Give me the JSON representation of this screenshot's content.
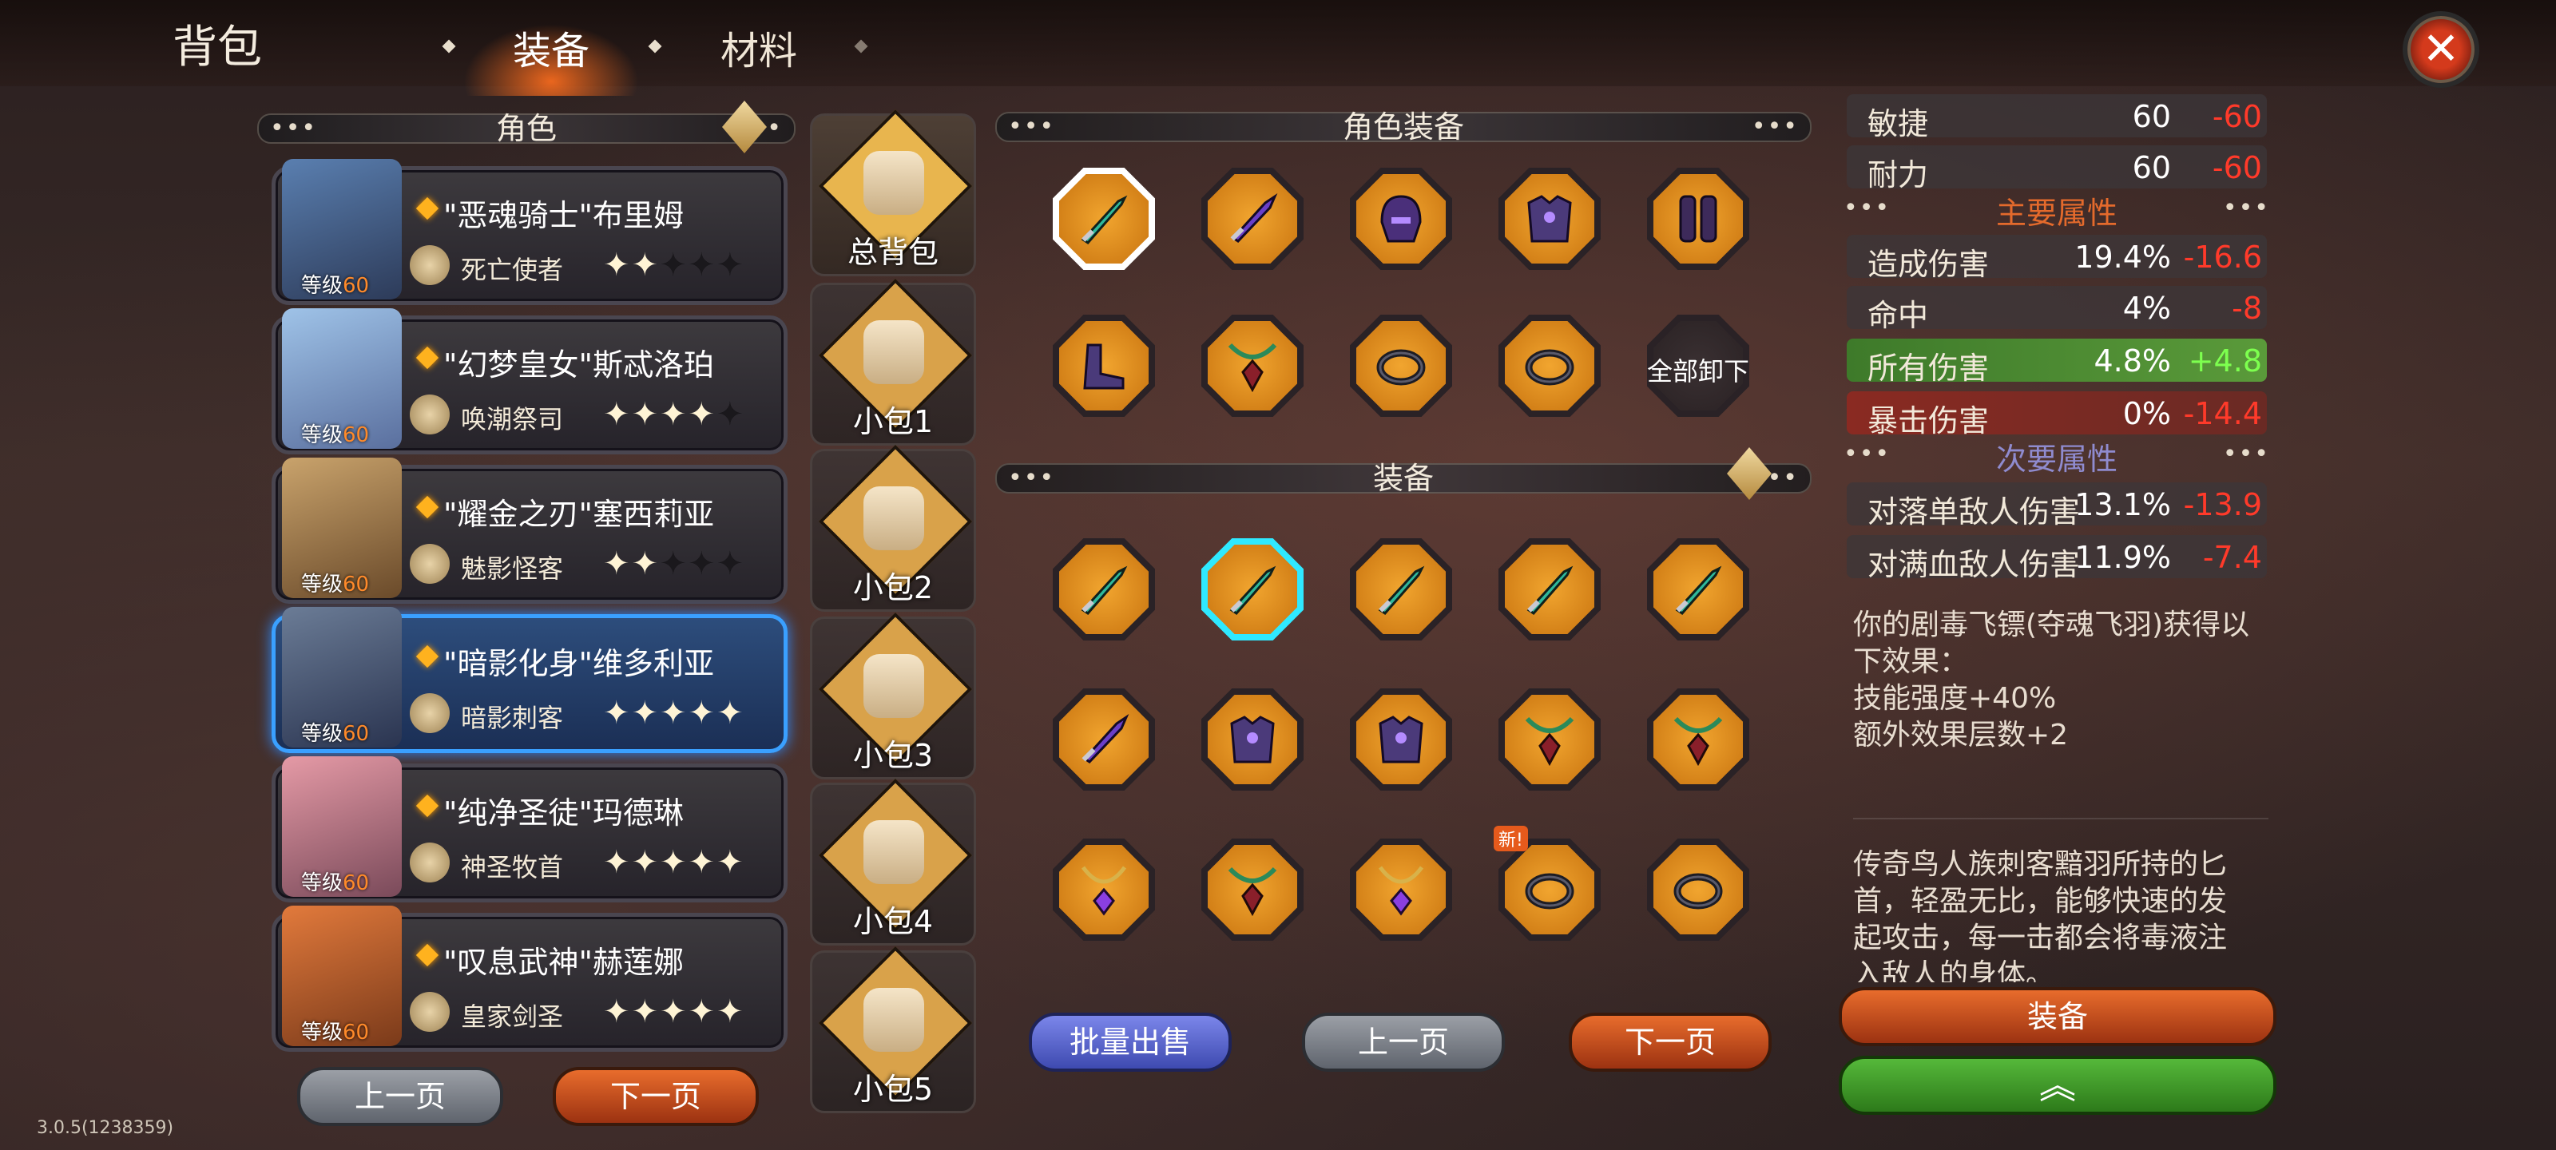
{
  "header": {
    "title": "背包",
    "tabs": [
      "装备",
      "材料"
    ]
  },
  "characters_panel": {
    "title": "角色",
    "characters": [
      {
        "name": "\"恶魂骑士\"布里姆",
        "class": "死亡使者",
        "level_label": "等级",
        "level": "60",
        "stars": 2,
        "colors": [
          "#5a7fb0",
          "#2d3b59"
        ]
      },
      {
        "name": "\"幻梦皇女\"斯忒洛珀",
        "class": "唤潮祭司",
        "level_label": "等级",
        "level": "60",
        "stars": 4,
        "colors": [
          "#9fc3e8",
          "#5a6f9e"
        ]
      },
      {
        "name": "\"耀金之刃\"塞西莉亚",
        "class": "魅影怪客",
        "level_label": "等级",
        "level": "60",
        "stars": 2,
        "colors": [
          "#c9a36c",
          "#6a4a2a"
        ]
      },
      {
        "name": "\"暗影化身\"维多利亚",
        "class": "暗影刺客",
        "level_label": "等级",
        "level": "60",
        "stars": 5,
        "selected": true,
        "colors": [
          "#6b7c96",
          "#2a3450"
        ]
      },
      {
        "name": "\"纯净圣徒\"玛德琳",
        "class": "神圣牧首",
        "level_label": "等级",
        "level": "60",
        "stars": 5,
        "colors": [
          "#e59aa6",
          "#7a4a5a"
        ]
      },
      {
        "name": "\"叹息武神\"赫莲娜",
        "class": "皇家剑圣",
        "level_label": "等级",
        "level": "60",
        "stars": 5,
        "colors": [
          "#e27a3c",
          "#7a3a1a"
        ]
      }
    ],
    "prev_label": "上一页",
    "next_label": "下一页"
  },
  "bags": [
    "总背包",
    "小包1",
    "小包2",
    "小包3",
    "小包4",
    "小包5"
  ],
  "character_equipment": {
    "title": "角色装备",
    "slots": [
      "dagger-icon",
      "sword-icon",
      "helmet-icon",
      "armor-icon",
      "greaves-icon",
      "boots-icon",
      "amulet-icon",
      "ring-icon",
      "ring-icon"
    ],
    "unequip_all_label": "全部卸下"
  },
  "inventory": {
    "title": "装备",
    "items": [
      "dagger-icon",
      "dagger-icon",
      "dagger-icon",
      "dagger-icon",
      "dagger-icon",
      "sword-icon",
      "armor-icon",
      "armor-icon",
      "amulet-icon",
      "amulet-icon",
      "necklace-icon",
      "amulet-icon",
      "necklace-icon",
      "ring-icon",
      "ring-icon"
    ],
    "new_tag": "新!",
    "batch_sell_label": "批量出售",
    "prev_label": "上一页",
    "next_label": "下一页"
  },
  "stats": {
    "top": [
      {
        "name": "敏捷",
        "value": "60",
        "diff": "-60"
      },
      {
        "name": "耐力",
        "value": "60",
        "diff": "-60"
      }
    ],
    "main_header": "主要属性",
    "main": [
      {
        "name": "造成伤害",
        "value": "19.4%",
        "diff": "-16.6"
      },
      {
        "name": "命中",
        "value": "4%",
        "diff": "-8"
      },
      {
        "name": "所有伤害",
        "value": "4.8%",
        "diff": "+4.8",
        "highlight": "green"
      },
      {
        "name": "暴击伤害",
        "value": "0%",
        "diff": "-14.4",
        "highlight": "red"
      }
    ],
    "secondary_header": "次要属性",
    "secondary": [
      {
        "name": "对落单敌人伤害",
        "value": "13.1%",
        "diff": "-13.9"
      },
      {
        "name": "对满血敌人伤害",
        "value": "11.9%",
        "diff": "-7.4"
      }
    ]
  },
  "effect_text": [
    "你的剧毒飞镖(夺魂飞羽)获得以",
    "下效果：",
    "技能强度+40%",
    "额外效果层数+2"
  ],
  "lore_text": [
    "传奇鸟人族刺客黯羽所持的匕",
    "首，轻盈无比，能够快速的发",
    "起攻击，每一击都会将毒液注",
    "入敌人的身体。"
  ],
  "actions": {
    "equip_label": "装备"
  },
  "version": "3.0.5(1238359)",
  "colors": {
    "accent_orange": "#e86c2c",
    "selected_blue": "#3aa0ff",
    "stat_negative": "#ff3a2a",
    "stat_positive": "#7dff4f"
  }
}
